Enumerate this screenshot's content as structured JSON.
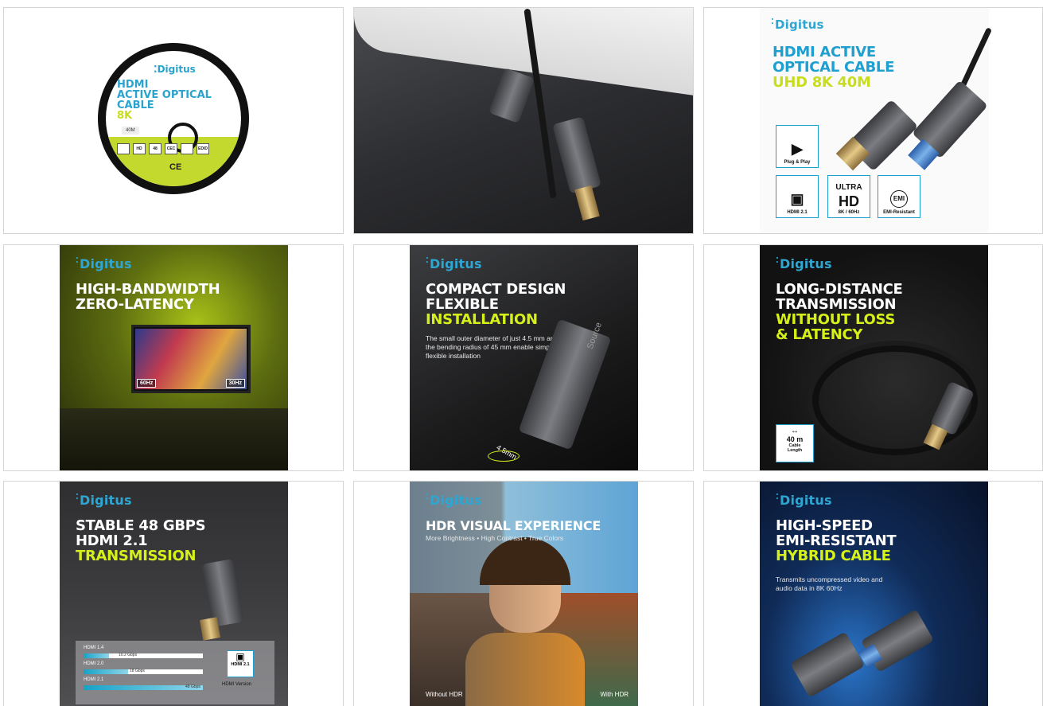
{
  "brand": "Digitus",
  "tiles": {
    "t1": {
      "brand": "Digitus",
      "title_line1": "HDMI",
      "title_line2": "ACTIVE OPTICAL",
      "title_line3": "CABLE",
      "title_line4": "8K",
      "length": "40M",
      "icons": [
        "",
        "HD",
        "48",
        "CEC",
        "",
        "EDID"
      ],
      "ce": "CE"
    },
    "t3": {
      "line1": "HDMI ACTIVE",
      "line2": "OPTICAL CABLE",
      "line3": "UHD 8K 40M",
      "f1": "Plug & Play",
      "f2": "HDMI 2.1",
      "f3_top": "ULTRA",
      "f3_big": "HD",
      "f3": "8K / 60Hz",
      "f4_sym": "EMI",
      "f4": "EMI-Resistant"
    },
    "t4": {
      "line1": "HIGH-BANDWIDTH",
      "line2": "ZERO-LATENCY",
      "left_badge": "60Hz",
      "right_badge": "30Hz"
    },
    "t5": {
      "line1": "COMPACT DESIGN",
      "line2": "FLEXIBLE",
      "line3": "INSTALLATION",
      "sub": "The small outer diameter of just 4.5 mm and the bending radius of 45 mm enable simple and flexible installation",
      "source": "Source",
      "dim": "4.5mm"
    },
    "t6": {
      "line1": "LONG-DISTANCE",
      "line2": "TRANSMISSION",
      "line3": "WITHOUT LOSS",
      "line4": "& LATENCY",
      "len_val": "40 m",
      "len_lab1": "Cable",
      "len_lab2": "Length"
    },
    "t7": {
      "line1": "STABLE 48 GBPS",
      "line2": "HDMI 2.1",
      "line3": "TRANSMISSION",
      "bars": [
        {
          "label": "HDMI 1.4",
          "value": "10.2 Gbps",
          "fraction": 0.21
        },
        {
          "label": "HDMI 2.0",
          "value": "18 Gbps",
          "fraction": 0.375
        },
        {
          "label": "HDMI 2.1",
          "value": "48 Gbps",
          "fraction": 1.0
        }
      ],
      "version_badge": "HDMI 2.1",
      "version_label": "HDMI Version"
    },
    "t8": {
      "title": "HDR VISUAL EXPERIENCE",
      "sub": "More Brightness • High Contrast • True Colors",
      "left": "Without HDR",
      "right": "With HDR"
    },
    "t9": {
      "line1": "HIGH-SPEED",
      "line2": "EMI-RESISTANT",
      "line3": "HYBRID CABLE",
      "sub": "Transmits uncompressed video and audio data in 8K 60Hz"
    }
  },
  "colors": {
    "accent": "#2fa6d2",
    "lime": "#d6f01a"
  }
}
